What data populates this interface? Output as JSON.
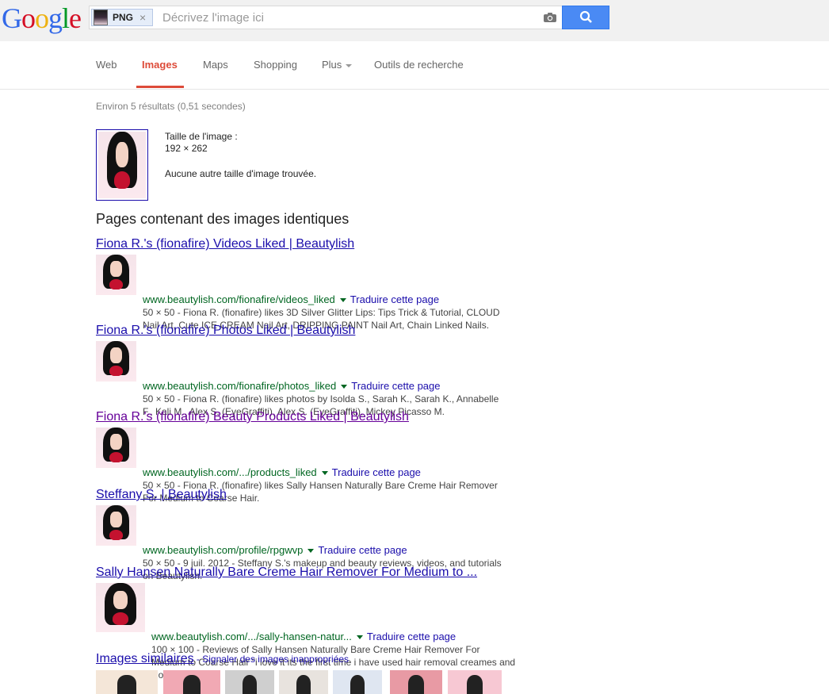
{
  "logo": {
    "text": "Google",
    "letters": [
      {
        "ch": "G",
        "color": "#3369e8"
      },
      {
        "ch": "o",
        "color": "#d50f25"
      },
      {
        "ch": "o",
        "color": "#eeb211"
      },
      {
        "ch": "g",
        "color": "#3369e8"
      },
      {
        "ch": "l",
        "color": "#009925"
      },
      {
        "ch": "e",
        "color": "#d50f25"
      }
    ]
  },
  "search": {
    "chip_label": "PNG",
    "chip_close": "×",
    "placeholder": "Décrivez l'image ici"
  },
  "nav": {
    "tabs": [
      "Web",
      "Images",
      "Maps",
      "Shopping",
      "Plus",
      "Outils de recherche"
    ],
    "active": "Images"
  },
  "stats": "Environ 5 résultats (0,51 secondes)",
  "image_info": {
    "size_label": "Taille de l'image :",
    "size_value": "192 × 262",
    "no_other": "Aucune autre taille d'image trouvée."
  },
  "section_heading": "Pages contenant des images identiques",
  "results": [
    {
      "title": "Fiona R.'s (fionafire) Videos Liked | Beautylish",
      "url": "www.beautylish.com/fionafire/videos_liked",
      "translate": "Traduire cette page",
      "snippet": "50 × 50 - Fiona R. (fionafire) likes 3D Silver Glitter Lips: Tips Trick & Tutorial, CLOUD Nail Art, Cute ICE CREAM Nail Art, DRIPPING PAINT Nail Art, Chain Linked Nails."
    },
    {
      "title": "Fiona R.'s (fionafire) Photos Liked | Beautylish",
      "url": "www.beautylish.com/fionafire/photos_liked",
      "translate": "Traduire cette page",
      "snippet": "50 × 50 - Fiona R. (fionafire) likes photos by Isolda S., Sarah K., Sarah K., Annabelle F., Kali M., Alex S. (EyeGraffiti), Alex S. (EyeGraffiti), Mickey Picasso M."
    },
    {
      "title": "Fiona R.'s (fionafire) Beauty Products Liked | Beautylish",
      "url": "www.beautylish.com/.../products_liked",
      "translate": "Traduire cette page",
      "snippet": "50 × 50 - Fiona R. (fionafire) likes Sally Hansen Naturally Bare Creme Hair Remover For Medium to Coarse Hair."
    },
    {
      "title": "Steffany S. | Beautylish",
      "url": "www.beautylish.com/profile/rpgwvp",
      "translate": "Traduire cette page",
      "snippet": "50 × 50 - 9 juil. 2012 - Steffany S.'s makeup and beauty reviews, videos, and tutorials on Beautylish."
    },
    {
      "title": "Sally Hansen Naturally Bare Creme Hair Remover For Medium to ...",
      "url": "www.beautylish.com/.../sally-hansen-natur...",
      "translate": "Traduire cette page",
      "snippet": "100 × 100 - Reviews of Sally Hansen Naturally Bare Creme Hair Remover For Medium to Coarse Hair \"i love it its the first time i have used hair removal creames and i love  ..."
    }
  ],
  "similar": {
    "title": "Images similaires",
    "separator": " - ",
    "report": "Signaler des images inappropriées"
  }
}
